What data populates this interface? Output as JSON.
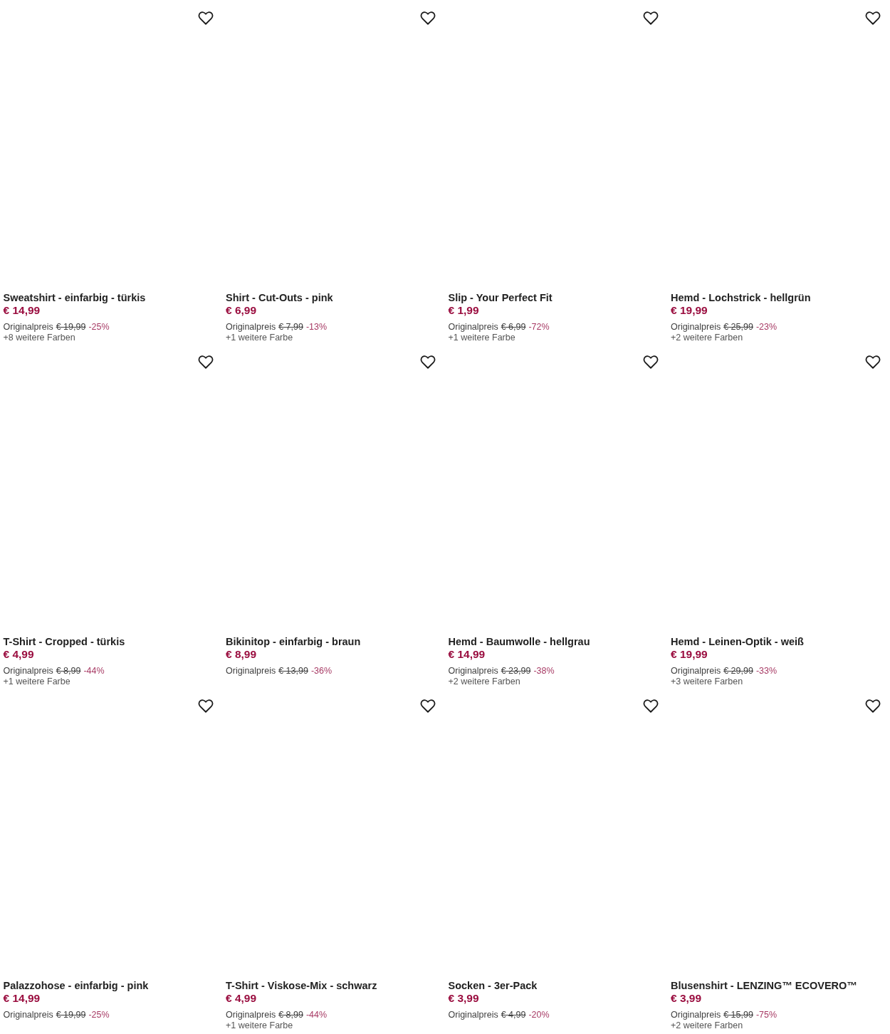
{
  "products": [
    {
      "name": "Sweatshirt - einfarbig - türkis",
      "price": "€ 14,99",
      "original_label": "Originalpreis",
      "original_price": "€ 19,99",
      "discount": "-25%",
      "more_colors": "+8 weitere Farben"
    },
    {
      "name": "Shirt - Cut-Outs - pink",
      "price": "€ 6,99",
      "original_label": "Originalpreis",
      "original_price": "€ 7,99",
      "discount": "-13%",
      "more_colors": "+1 weitere Farbe"
    },
    {
      "name": "Slip - Your Perfect Fit",
      "price": "€ 1,99",
      "original_label": "Originalpreis",
      "original_price": "€ 6,99",
      "discount": "-72%",
      "more_colors": "+1 weitere Farbe"
    },
    {
      "name": "Hemd - Lochstrick - hellgrün",
      "price": "€ 19,99",
      "original_label": "Originalpreis",
      "original_price": "€ 25,99",
      "discount": "-23%",
      "more_colors": "+2 weitere Farben"
    },
    {
      "name": "T-Shirt - Cropped - türkis",
      "price": "€ 4,99",
      "original_label": "Originalpreis",
      "original_price": "€ 8,99",
      "discount": "-44%",
      "more_colors": "+1 weitere Farbe"
    },
    {
      "name": "Bikinitop - einfarbig - braun",
      "price": "€ 8,99",
      "original_label": "Originalpreis",
      "original_price": "€ 13,99",
      "discount": "-36%"
    },
    {
      "name": "Hemd - Baumwolle - hellgrau",
      "price": "€ 14,99",
      "original_label": "Originalpreis",
      "original_price": "€ 23,99",
      "discount": "-38%",
      "more_colors": "+2 weitere Farben"
    },
    {
      "name": "Hemd - Leinen-Optik - weiß",
      "price": "€ 19,99",
      "original_label": "Originalpreis",
      "original_price": "€ 29,99",
      "discount": "-33%",
      "more_colors": "+3 weitere Farben"
    },
    {
      "name": "Palazzohose - einfarbig - pink",
      "price": "€ 14,99",
      "original_label": "Originalpreis",
      "original_price": "€ 19,99",
      "discount": "-25%"
    },
    {
      "name": "T-Shirt - Viskose-Mix - schwarz",
      "price": "€ 4,99",
      "original_label": "Originalpreis",
      "original_price": "€ 8,99",
      "discount": "-44%",
      "more_colors": "+1 weitere Farbe"
    },
    {
      "name": "Socken - 3er-Pack",
      "price": "€ 3,99",
      "original_label": "Originalpreis",
      "original_price": "€ 4,99",
      "discount": "-20%"
    },
    {
      "name": "Blusenshirt - LENZING™ ECOVERO™",
      "price": "€ 3,99",
      "original_label": "Originalpreis",
      "original_price": "€ 15,99",
      "discount": "-75%",
      "more_colors": "+2 weitere Farben"
    }
  ]
}
